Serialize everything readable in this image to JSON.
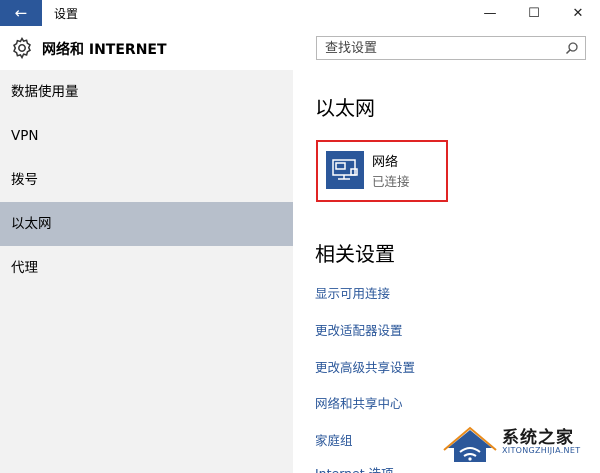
{
  "window": {
    "back_glyph": "←",
    "title": "设置",
    "controls": {
      "minimize": "—",
      "maximize": "☐",
      "close": "✕"
    }
  },
  "header": {
    "icon": "gear-icon",
    "title": "网络和 INTERNET",
    "search_placeholder": "查找设置"
  },
  "sidebar": {
    "items": [
      {
        "label": "数据使用量",
        "active": false
      },
      {
        "label": "VPN",
        "active": false
      },
      {
        "label": "拨号",
        "active": false
      },
      {
        "label": "以太网",
        "active": true
      },
      {
        "label": "代理",
        "active": false
      }
    ]
  },
  "main": {
    "section_title": "以太网",
    "network": {
      "name": "网络",
      "status": "已连接",
      "icon": "ethernet-monitor-icon"
    },
    "related_title": "相关设置",
    "links": [
      "显示可用连接",
      "更改适配器设置",
      "更改高级共享设置",
      "网络和共享中心",
      "家庭组",
      "Internet 选项"
    ]
  },
  "watermark": {
    "text": "系统之家",
    "sub": "XITONGZHIJIA.NET"
  },
  "colors": {
    "accent": "#2b579a",
    "active_nav": "#b7bfcb",
    "sidebar_bg": "#f2f2f2",
    "highlight_border": "#e02424"
  }
}
